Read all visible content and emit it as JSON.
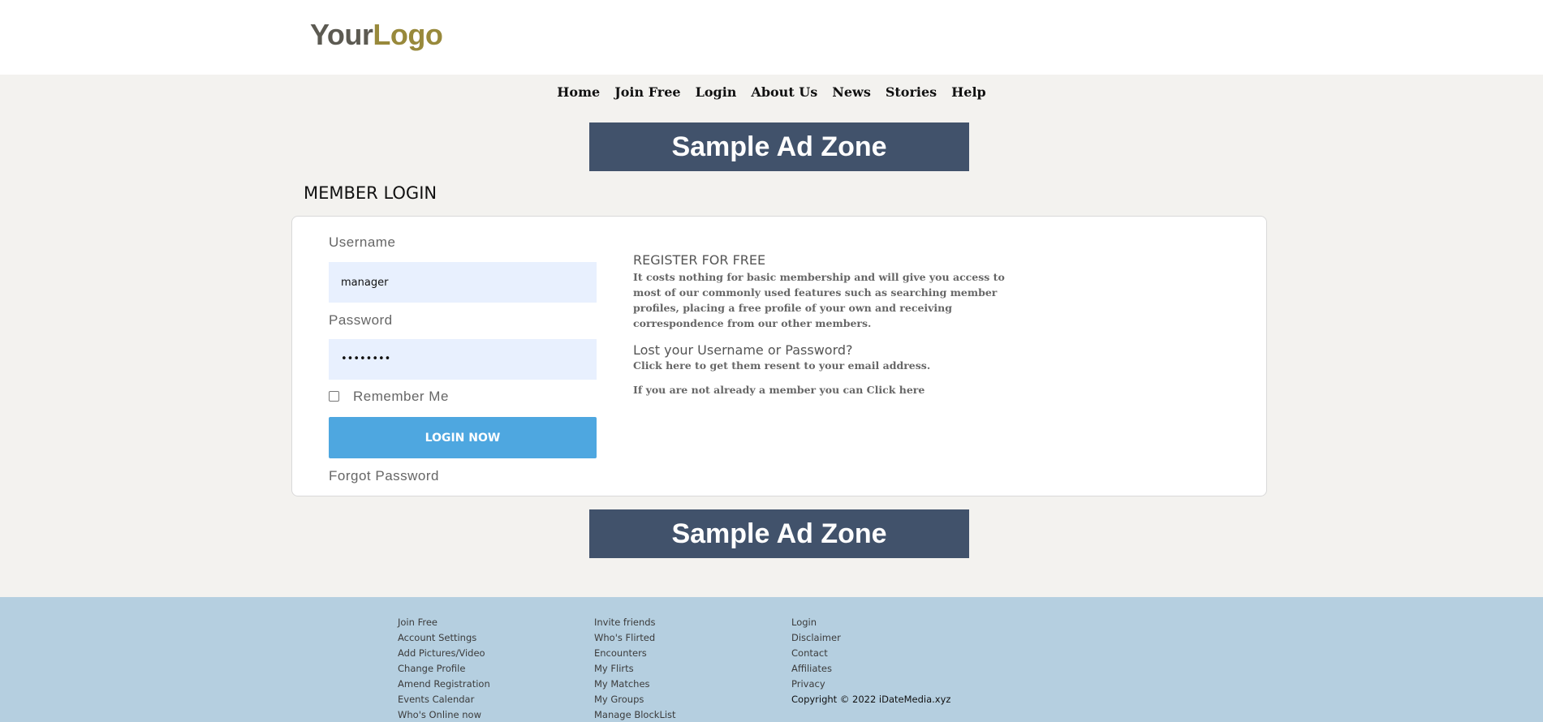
{
  "logo": {
    "part1": "Your",
    "part2": "Logo"
  },
  "nav": [
    {
      "label": "Home"
    },
    {
      "label": "Join Free"
    },
    {
      "label": "Login"
    },
    {
      "label": "About Us"
    },
    {
      "label": "News"
    },
    {
      "label": "Stories"
    },
    {
      "label": "Help"
    }
  ],
  "ads": {
    "top": "Sample Ad Zone",
    "bottom": "Sample Ad Zone"
  },
  "page_title": "MEMBER LOGIN",
  "login": {
    "username_label": "Username",
    "username_value": "manager",
    "password_label": "Password",
    "password_value": "••••••••",
    "remember_label": "Remember Me",
    "login_button": "LOGIN NOW",
    "forgot_link": "Forgot Password"
  },
  "register": {
    "heading": "REGISTER FOR FREE",
    "body": "It costs nothing for basic membership and will give you access to most of our commonly used features such as searching member profiles, placing a free profile of your own and receiving correspondence from our other members.",
    "lost_heading": "Lost your Username or Password?",
    "lost_link": "Click here to get them resent to your email address.",
    "join_link": "If you are not already a member you can Click here"
  },
  "footer": {
    "col1": [
      "Join Free",
      "Account Settings",
      "Add Pictures/Video",
      "Change Profile",
      "Amend Registration",
      "Events Calendar",
      "Who's Online now"
    ],
    "col2": [
      "Invite friends",
      "Who's Flirted",
      "Encounters",
      "My Flirts",
      "My Matches",
      "My Groups",
      "Manage BlockList"
    ],
    "col3": [
      "Login",
      "Disclaimer",
      "Contact",
      "Affiliates",
      "Privacy"
    ],
    "copyright": "Copyright © 2022 iDateMedia.xyz"
  },
  "colors": {
    "ad_bg": "#41526b",
    "button": "#4ea7e0",
    "footer_bg": "#b5cfe0",
    "logo_accent": "#98893b"
  }
}
